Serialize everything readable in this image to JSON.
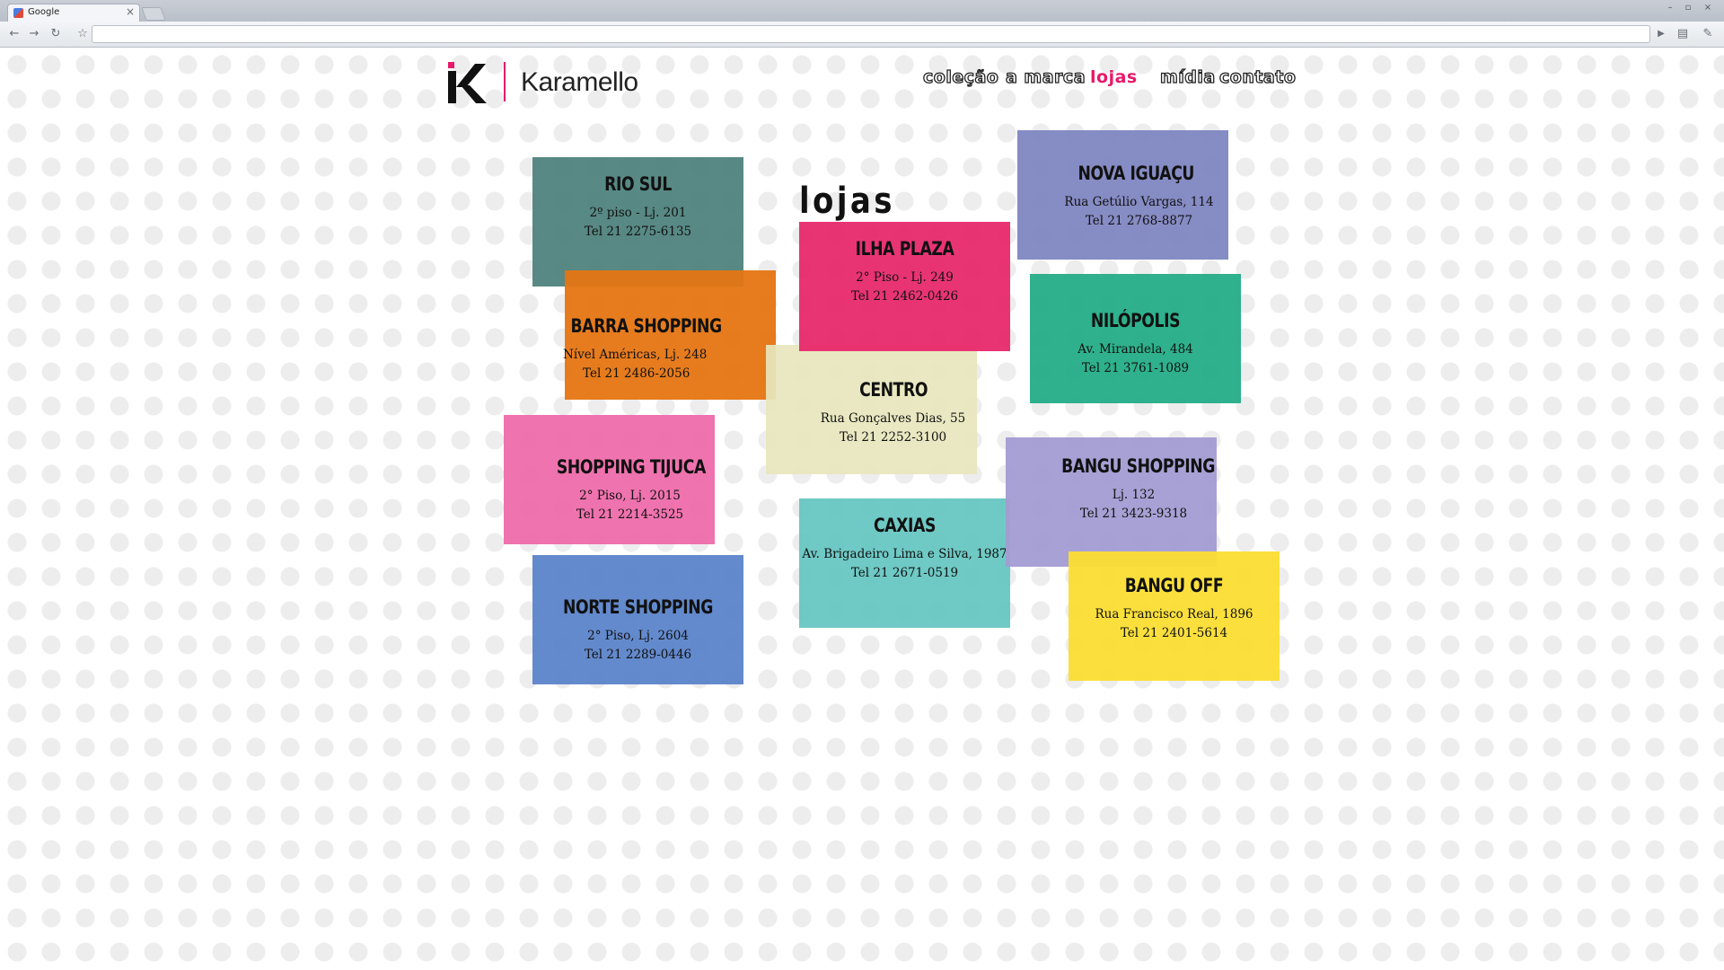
{
  "browser": {
    "tab_title": "Google",
    "tab_close": "×",
    "back_icon": "back-arrow-icon",
    "forward_icon": "forward-arrow-icon",
    "reload_icon": "reload-icon",
    "star_icon": "star-icon",
    "nav_glyphs": {
      "back": "←",
      "forward": "→",
      "reload": "↻",
      "star": "☆",
      "play": "▶",
      "page": "▤",
      "wrench": "✎",
      "minimize": "–",
      "maximize": "▫",
      "close": "×"
    }
  },
  "header": {
    "brand": "Karamello",
    "logo_colors": {
      "mark": "#111111",
      "accent": "#e8196a"
    }
  },
  "nav": {
    "items": [
      {
        "label": "coleção",
        "active": false
      },
      {
        "label": "a marca",
        "active": false
      },
      {
        "label": "lojas",
        "active": true
      },
      {
        "label": "mídia",
        "active": false
      },
      {
        "label": "contato",
        "active": false
      }
    ],
    "active_color": "#e8196a"
  },
  "main": {
    "heading": "lojas",
    "stores": [
      {
        "name": "RIO SUL",
        "address": "2º piso - Lj. 201",
        "phone": "Tel 21 2275-6135",
        "color": "#4a7f79"
      },
      {
        "name": "BARRA SHOPPING",
        "address": "Nível Américas, Lj. 248",
        "phone": "Tel 21 2486-2056",
        "color": "#e57512"
      },
      {
        "name": "SHOPPING TIJUCA",
        "address": "2° Piso, Lj. 2015",
        "phone": "Tel 21 2214-3525",
        "color": "#ee6bab"
      },
      {
        "name": "NORTE SHOPPING",
        "address": "2° Piso, Lj. 2604",
        "phone": "Tel 21 2289-0446",
        "color": "#5b84c9"
      },
      {
        "name": "ILHA PLAZA",
        "address": "2° Piso - Lj. 249",
        "phone": "Tel 21 2462-0426",
        "color": "#e8296c"
      },
      {
        "name": "CENTRO",
        "address": "Rua Gonçalves Dias, 55",
        "phone": "Tel 21 2252-3100",
        "color": "#e7e6bd"
      },
      {
        "name": "CAXIAS",
        "address": "Av. Brigadeiro Lima e Silva, 1987",
        "phone": "Tel 21 2671-0519",
        "color": "#63c4c0"
      },
      {
        "name": "NOVA IGUAÇU",
        "address": "Rua Getúlio Vargas, 114",
        "phone": "Tel 21 2768-8877",
        "color": "#7f86c1"
      },
      {
        "name": "NILÓPOLIS",
        "address": "Av. Mirandela, 484",
        "phone": "Tel 21 3761-1089",
        "color": "#23ad86"
      },
      {
        "name": "BANGU SHOPPING",
        "address": "Lj. 132",
        "phone": "Tel 21 3423-9318",
        "color": "#a39cd3"
      },
      {
        "name": "BANGU OFF",
        "address": "Rua Francisco Real, 1896",
        "phone": "Tel 21 2401-5614",
        "color": "#fbde33"
      }
    ]
  }
}
